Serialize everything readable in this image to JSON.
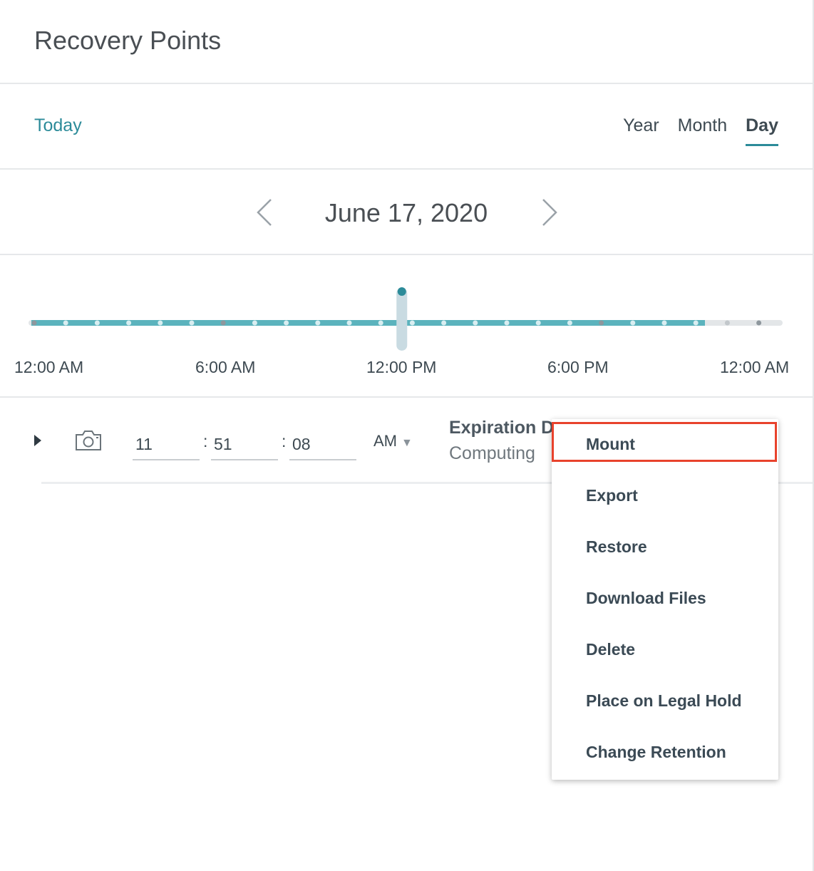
{
  "panel": {
    "title": "Recovery Points"
  },
  "toolbar": {
    "today_label": "Today",
    "views": [
      {
        "label": "Year",
        "active": false
      },
      {
        "label": "Month",
        "active": false
      },
      {
        "label": "Day",
        "active": true
      }
    ]
  },
  "date_nav": {
    "date": "June 17, 2020",
    "prev_icon": "chevron-left-icon",
    "next_icon": "chevron-right-icon"
  },
  "timeline": {
    "labels": [
      "12:00 AM",
      "6:00 AM",
      "12:00 PM",
      "6:00 PM",
      "12:00 AM"
    ],
    "selected_fraction": 0.495,
    "filled_fraction": 0.9,
    "accent_color": "#5bb3bd",
    "handle_color": "#2c8b99"
  },
  "recovery_point": {
    "hour": "11",
    "minute": "51",
    "second": "08",
    "meridiem": "AM",
    "expiration_label": "Expiration Date",
    "expiration_value": "Computing"
  },
  "context_menu": {
    "items": [
      "Mount",
      "Export",
      "Restore",
      "Download Files",
      "Delete",
      "Place on Legal Hold",
      "Change Retention"
    ],
    "highlighted_item": "Mount",
    "highlight_color": "#e8422c"
  }
}
